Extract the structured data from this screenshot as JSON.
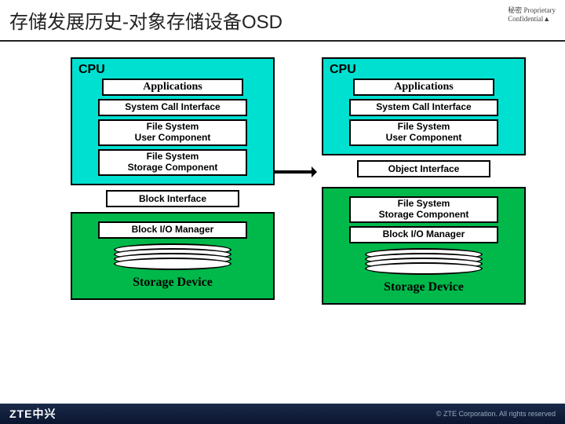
{
  "header": {
    "title": "存储发展历史-对象存储设备OSD",
    "confidential_line1": "秘密  Proprietary",
    "confidential_line2": "Confidential▲"
  },
  "left": {
    "cpu": "CPU",
    "apps": "Applications",
    "sci": "System Call Interface",
    "fs_user_1": "File System",
    "fs_user_2": "User Component",
    "fs_stor_1": "File System",
    "fs_stor_2": "Storage Component",
    "iface": "Block Interface",
    "biom": "Block I/O Manager",
    "dev": "Storage Device"
  },
  "right": {
    "cpu": "CPU",
    "apps": "Applications",
    "sci": "System Call Interface",
    "fs_user_1": "File System",
    "fs_user_2": "User Component",
    "iface": "Object Interface",
    "fs_stor_1": "File System",
    "fs_stor_2": "Storage Component",
    "biom": "Block I/O Manager",
    "dev": "Storage Device"
  },
  "footer": {
    "logo": "ZTE中兴",
    "copy": "© ZTE Corporation. All rights reserved"
  }
}
